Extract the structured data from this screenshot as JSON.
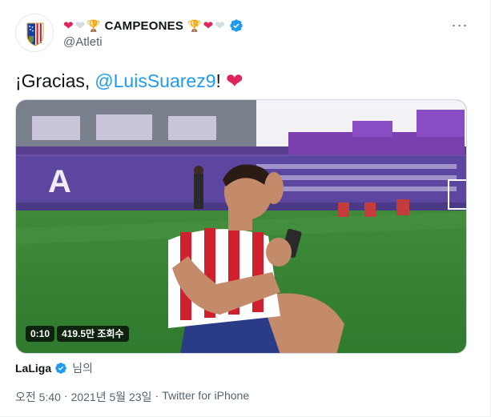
{
  "author": {
    "display_name": "CAMPEONES",
    "handle": "@Atleti",
    "verified": true,
    "name_emoji": [
      "red-heart",
      "white-heart",
      "trophy",
      "trophy",
      "red-heart",
      "white-heart"
    ]
  },
  "tweet": {
    "text_prefix": "¡Gracias, ",
    "mention": "@LuisSuarez9",
    "text_suffix": "!",
    "emoji": "red-heart"
  },
  "media": {
    "type": "video",
    "duration": "0:10",
    "views": "419.5만 조회수"
  },
  "attribution": {
    "name": "LaLiga",
    "verified": true,
    "suffix": "님의"
  },
  "meta": {
    "time": "오전 5:40",
    "separator1": "·",
    "date": "2021년 5월 23일",
    "separator2": "·",
    "source": "Twitter for iPhone"
  },
  "colors": {
    "link": "#1d9bf0",
    "heart": "#e0245e",
    "verified": "#1d9bf0",
    "secondary_text": "#536471"
  },
  "icons": {
    "more": "more-horizontal-icon",
    "verified": "verified-badge-icon"
  }
}
